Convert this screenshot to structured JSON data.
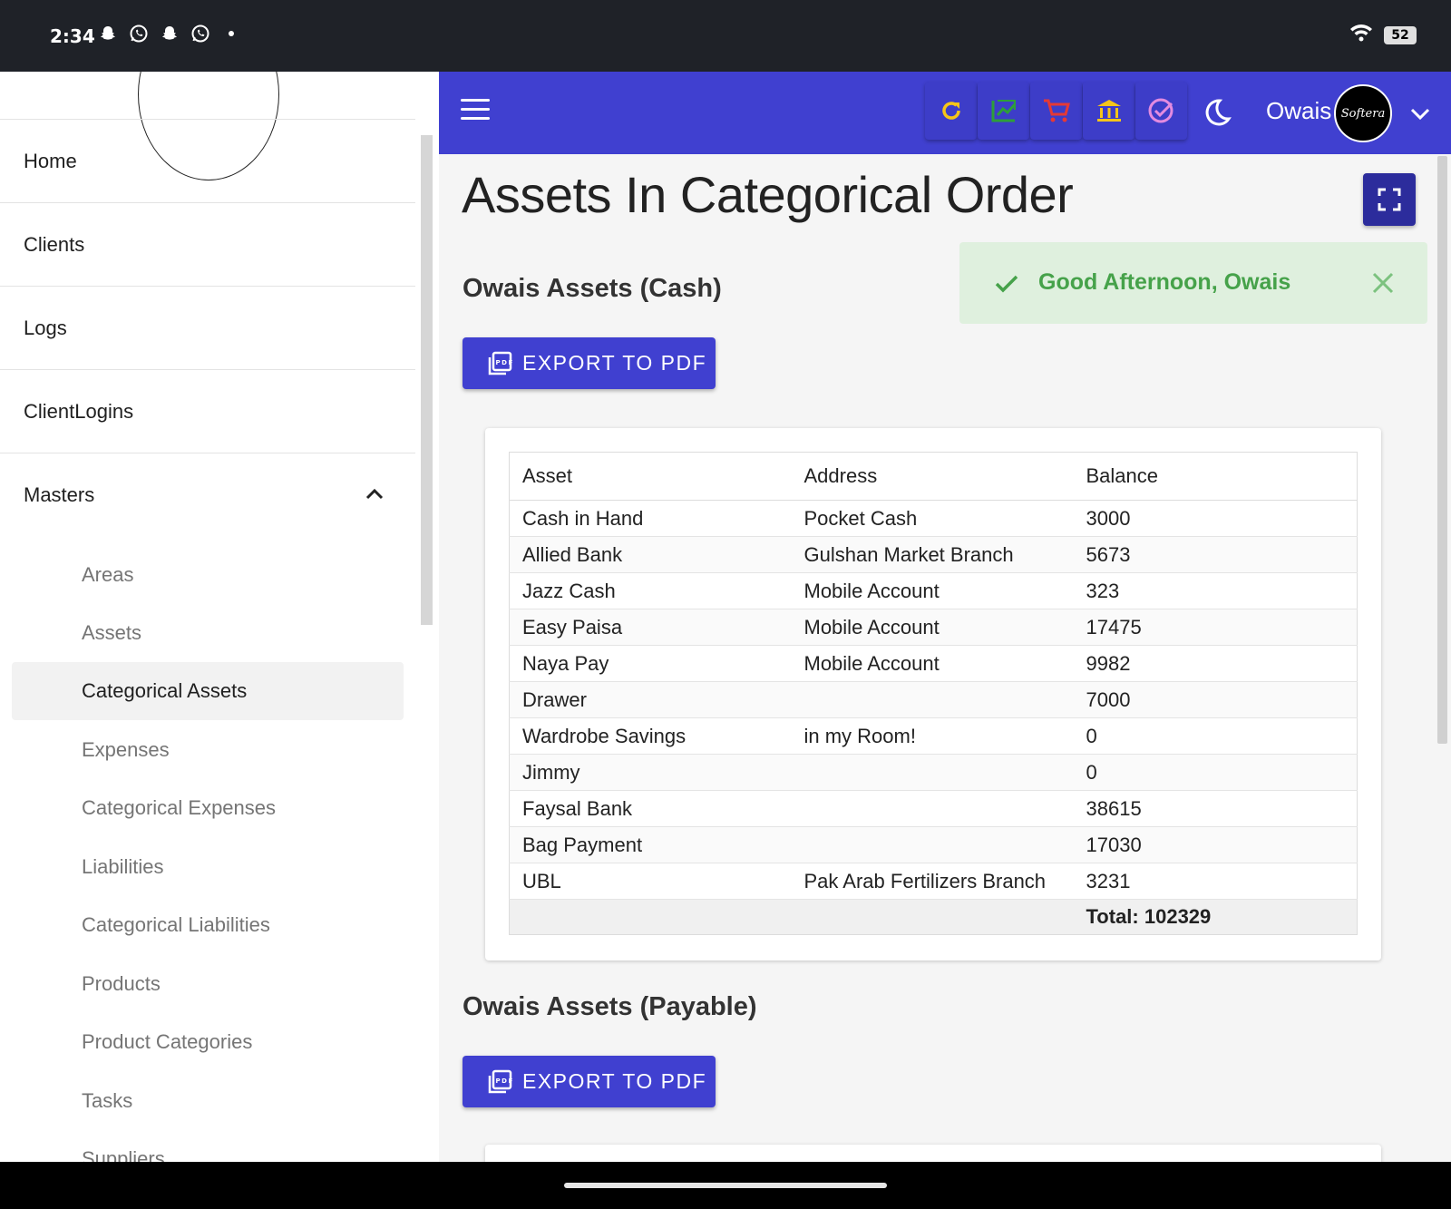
{
  "status_bar": {
    "time": "2:34",
    "battery": "52"
  },
  "sidebar": {
    "items": [
      {
        "label": "Home"
      },
      {
        "label": "Clients"
      },
      {
        "label": "Logs"
      },
      {
        "label": "ClientLogins"
      },
      {
        "label": "Masters"
      }
    ],
    "masters_subitems": [
      {
        "label": "Areas"
      },
      {
        "label": "Assets"
      },
      {
        "label": "Categorical Assets",
        "active": true
      },
      {
        "label": "Expenses"
      },
      {
        "label": "Categorical Expenses"
      },
      {
        "label": "Liabilities"
      },
      {
        "label": "Categorical Liabilities"
      },
      {
        "label": "Products"
      },
      {
        "label": "Product Categories"
      },
      {
        "label": "Tasks"
      },
      {
        "label": "Suppliers"
      }
    ]
  },
  "appbar": {
    "username": "Owais",
    "avatar_text": "Softera",
    "tool_colors": {
      "refresh": "#f5c518",
      "chart": "#2e9e3a",
      "cart": "#e53935",
      "bank": "#f5c518",
      "tasks": "#e38be0"
    }
  },
  "main": {
    "title": "Assets In Categorical Order",
    "toast": {
      "message": "Good Afternoon, Owais"
    },
    "cash_section": {
      "title": "Owais Assets (Cash)",
      "export_label": "EXPORT TO PDF",
      "columns": [
        "Asset",
        "Address",
        "Balance"
      ],
      "rows": [
        {
          "asset": "Cash in Hand",
          "address": "Pocket Cash",
          "balance": "3000"
        },
        {
          "asset": "Allied Bank",
          "address": "Gulshan Market Branch",
          "balance": "5673"
        },
        {
          "asset": "Jazz Cash",
          "address": "Mobile Account",
          "balance": "323"
        },
        {
          "asset": "Easy Paisa",
          "address": "Mobile Account",
          "balance": "17475"
        },
        {
          "asset": "Naya Pay",
          "address": "Mobile Account",
          "balance": "9982"
        },
        {
          "asset": "Drawer",
          "address": "",
          "balance": "7000"
        },
        {
          "asset": "Wardrobe Savings",
          "address": "in my Room!",
          "balance": "0"
        },
        {
          "asset": "Jimmy",
          "address": "",
          "balance": "0"
        },
        {
          "asset": "Faysal Bank",
          "address": "",
          "balance": "38615"
        },
        {
          "asset": "Bag Payment",
          "address": "",
          "balance": "17030"
        },
        {
          "asset": "UBL",
          "address": "Pak Arab Fertilizers Branch",
          "balance": "3231"
        }
      ],
      "total": "Total: 102329"
    },
    "payable_section": {
      "title": "Owais Assets (Payable)",
      "export_label": "EXPORT TO PDF"
    }
  }
}
